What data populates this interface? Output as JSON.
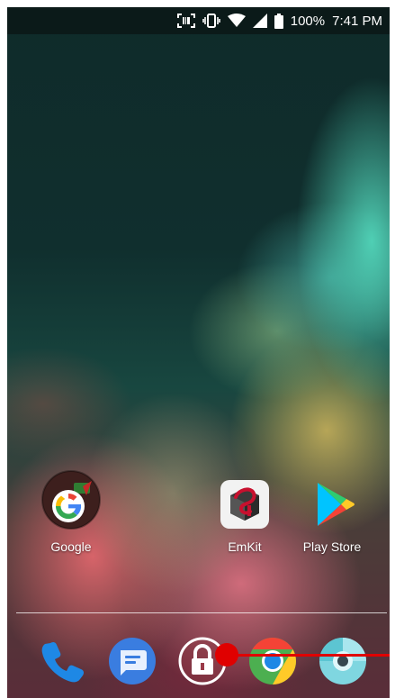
{
  "status_bar": {
    "icons": [
      "scan-icon",
      "vibrate-icon",
      "wifi-icon",
      "signal-icon",
      "battery-icon"
    ],
    "battery_percent": "100%",
    "time": "7:41 PM"
  },
  "home": {
    "apps": [
      {
        "label": "Google",
        "icon": "google-folder-icon"
      },
      {
        "label": "EmKit",
        "icon": "emkit-icon"
      },
      {
        "label": "Play Store",
        "icon": "play-store-icon"
      }
    ]
  },
  "dock": {
    "items": [
      {
        "icon": "phone-icon"
      },
      {
        "icon": "messages-icon"
      },
      {
        "icon": "lock-icon"
      },
      {
        "icon": "chrome-icon"
      },
      {
        "icon": "camera-icon"
      }
    ]
  },
  "colors": {
    "statusbar_bg": "#0b1a19",
    "touch_indicator": "#e00000",
    "google_blue": "#4285F4",
    "google_red": "#EA4335",
    "google_yellow": "#FBBC05",
    "google_green": "#34A853"
  }
}
